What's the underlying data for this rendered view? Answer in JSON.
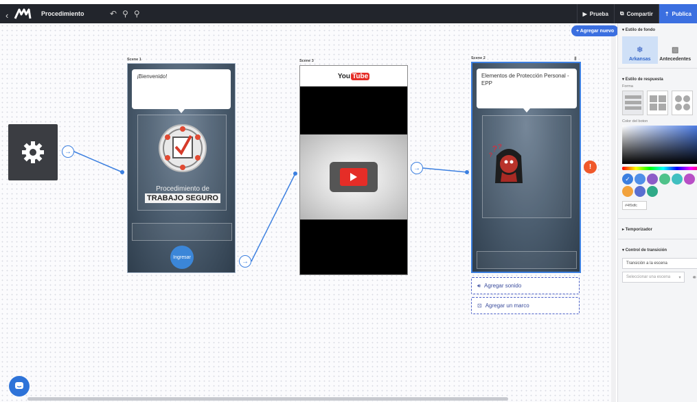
{
  "app": {
    "project_title": "Procedimiento",
    "toolbar": {
      "test_label": "Prueba",
      "share_label": "Compartir",
      "publish_label": "Publica"
    }
  },
  "canvas": {
    "add_new_label": "+ Agregar nuevo",
    "scenes": [
      {
        "label": "Scene 1",
        "bubble_text": "¡Bienvenido!",
        "logo_line1": "Procedimiento de",
        "logo_line2": "TRABAJO SEGURO",
        "button_label": "Ingresar"
      },
      {
        "label": "Scene 3",
        "youtube_text_you": "You",
        "youtube_text_tube": "Tube"
      },
      {
        "label": "Scene 2",
        "bubble_text": "Elementos de Protección Personal - EPP",
        "add_sound_label": "Agregar sonido",
        "add_frame_label": "Agregar un marco"
      }
    ],
    "warning_glyph": "!"
  },
  "panel": {
    "bg_style_header": "Estilo de fondo",
    "bg_tabs": [
      "Arkansas",
      "Antecedentes"
    ],
    "response_style_header": "Estilo de respuesta",
    "shape_label": "Forma",
    "button_color_label": "Color del boton",
    "swatches": [
      "#3b7fe0",
      "#4f8fe8",
      "#8d5cc8",
      "#4fc28a",
      "#40bfc0",
      "#b84fc6",
      "#f2a23c",
      "#5a6fd0",
      "#2faa88"
    ],
    "hex_value": "#4f9dfc",
    "timer_header": "Temporizador",
    "transition_header": "Control de transición",
    "transition_value": "Transición a la escena",
    "scene_select_placeholder": "Seleccionar una escena"
  },
  "colors": {
    "accent": "#3b6fe0",
    "topbar": "#22252c",
    "warning": "#f0582a"
  }
}
